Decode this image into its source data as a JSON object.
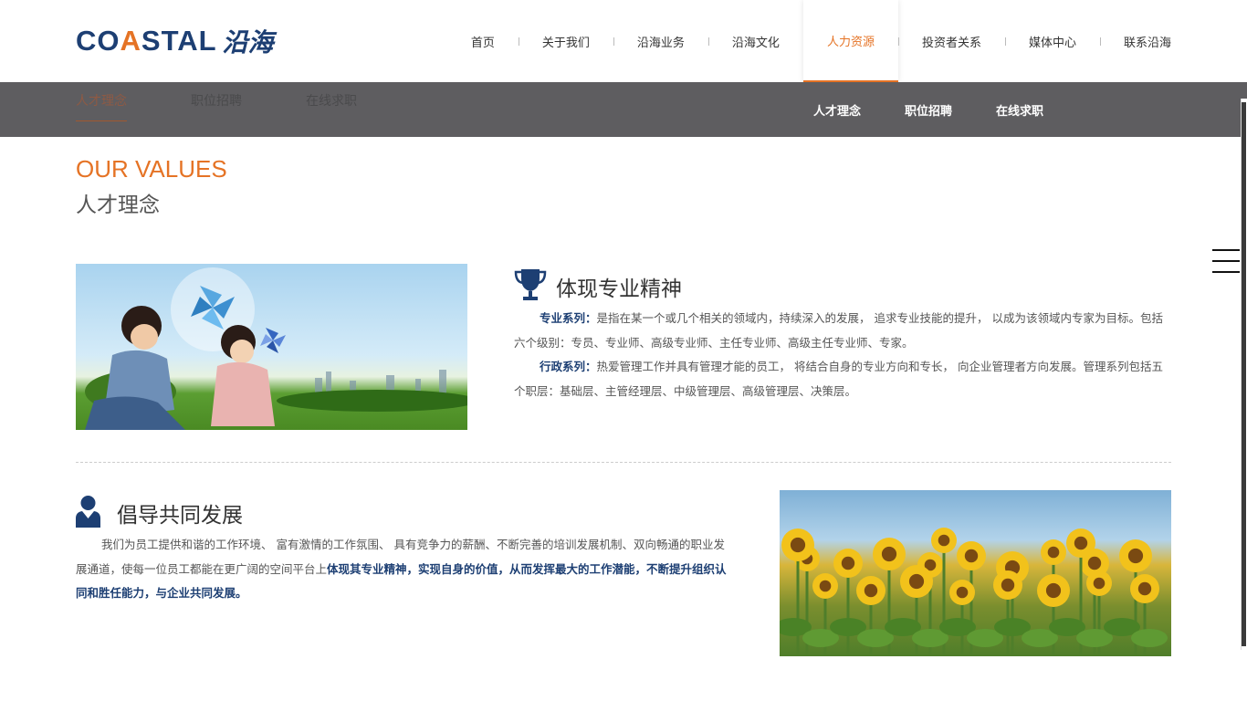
{
  "logo": {
    "en_pre": "CO",
    "en_a": "A",
    "en_post": "STAL",
    "cn": "沿海"
  },
  "nav": [
    {
      "label": "首页"
    },
    {
      "label": "关于我们"
    },
    {
      "label": "沿海业务"
    },
    {
      "label": "沿海文化"
    },
    {
      "label": "人力资源"
    },
    {
      "label": "投资者关系"
    },
    {
      "label": "媒体中心"
    },
    {
      "label": "联系沿海"
    }
  ],
  "nav_active": "人力资源",
  "subbar": {
    "ghost_tabs": [
      "人才理念",
      "职位招聘",
      "在线求职"
    ],
    "links": [
      "人才理念",
      "职位招聘",
      "在线求职"
    ]
  },
  "heading": {
    "en": "OUR VALUES",
    "cn": "人才理念"
  },
  "section1": {
    "title": "体现专业精神",
    "p1_label": "专业系列：",
    "p1_text": "是指在某一个或几个相关的领域内，持续深入的发展， 追求专业技能的提升， 以成为该领域内专家为目标。包括六个级别：专员、专业师、高级专业师、主任专业师、高级主任专业师、专家。",
    "p2_label": "行政系列：",
    "p2_text": "热爱管理工作并具有管理才能的员工， 将结合自身的专业方向和专长， 向企业管理者方向发展。管理系列包括五个职层：基础层、主管经理层、中级管理层、高级管理层、决策层。"
  },
  "section2": {
    "title": "倡导共同发展",
    "p_text": "我们为员工提供和谐的工作环境、 富有激情的工作氛围、 具有竞争力的薪酬、不断完善的培训发展机制、双向畅通的职业发展通道，使每一位员工都能在更广阔的空间平台上",
    "p_strong": "体现其专业精神，实现自身的价值，从而发挥最大的工作潜能，不断提升组织认同和胜任能力，与企业共同发展。"
  },
  "colors": {
    "brand_blue": "#1d3f73",
    "accent_orange": "#e57325",
    "subbar_gray": "#5e5d60"
  },
  "icons": {
    "section1": "trophy-icon",
    "section2": "user-icon",
    "menu": "hamburger-menu-icon"
  }
}
